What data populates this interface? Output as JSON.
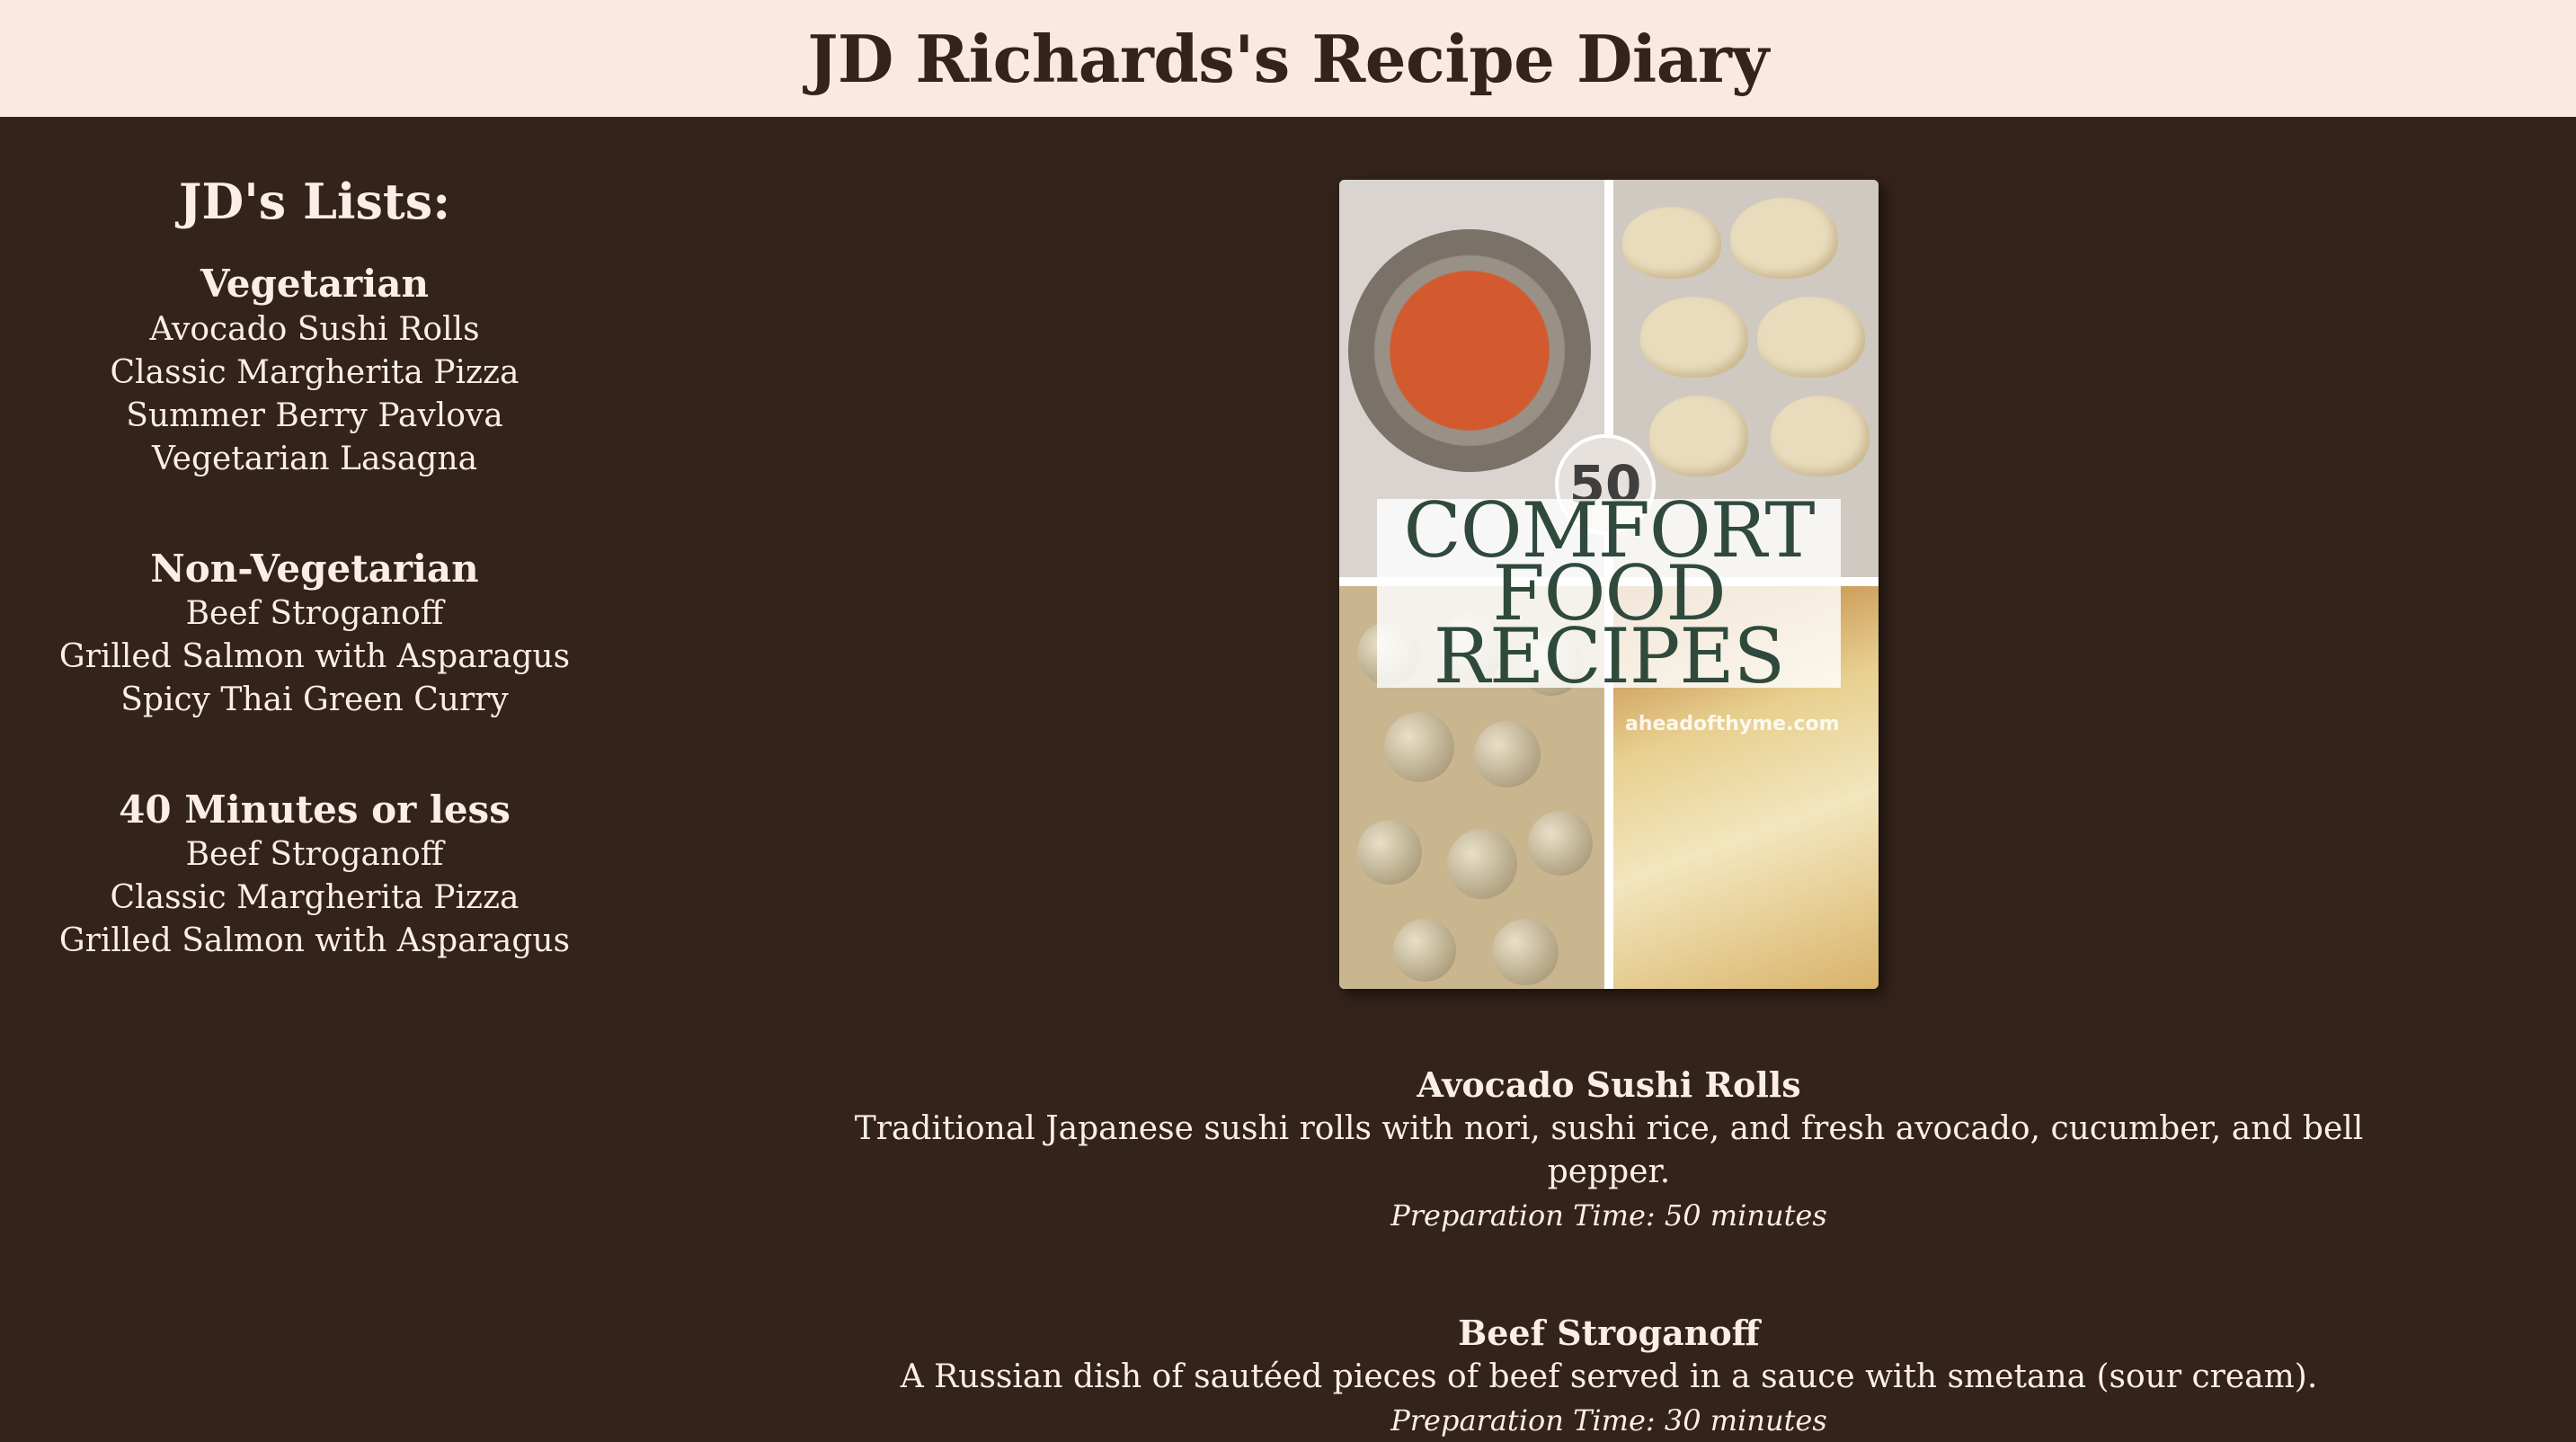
{
  "header": {
    "title": "JD Richards's Recipe Diary"
  },
  "sidebar": {
    "heading": "JD's Lists:",
    "groups": [
      {
        "title": "Vegetarian",
        "items": [
          "Avocado Sushi Rolls",
          "Classic Margherita Pizza",
          "Summer Berry Pavlova",
          "Vegetarian Lasagna"
        ]
      },
      {
        "title": "Non-Vegetarian",
        "items": [
          "Beef Stroganoff",
          "Grilled Salmon with Asparagus",
          "Spicy Thai Green Curry"
        ]
      },
      {
        "title": "40 Minutes or less",
        "items": [
          "Beef Stroganoff",
          "Classic Margherita Pizza",
          "Grilled Salmon with Asparagus"
        ]
      }
    ]
  },
  "cover": {
    "badge": "50",
    "title_lines": [
      "COMFORT",
      "FOOD",
      "RECIPES"
    ],
    "site": "aheadofthyme.com"
  },
  "recipes": [
    {
      "name": "Avocado Sushi Rolls",
      "description": "Traditional Japanese sushi rolls with nori, sushi rice, and fresh avocado, cucumber, and bell pepper.",
      "time": "Preparation Time: 50 minutes"
    },
    {
      "name": "Beef Stroganoff",
      "description": "A Russian dish of sautéed pieces of beef served in a sauce with smetana (sour cream).",
      "time": "Preparation Time: 30 minutes"
    }
  ]
}
